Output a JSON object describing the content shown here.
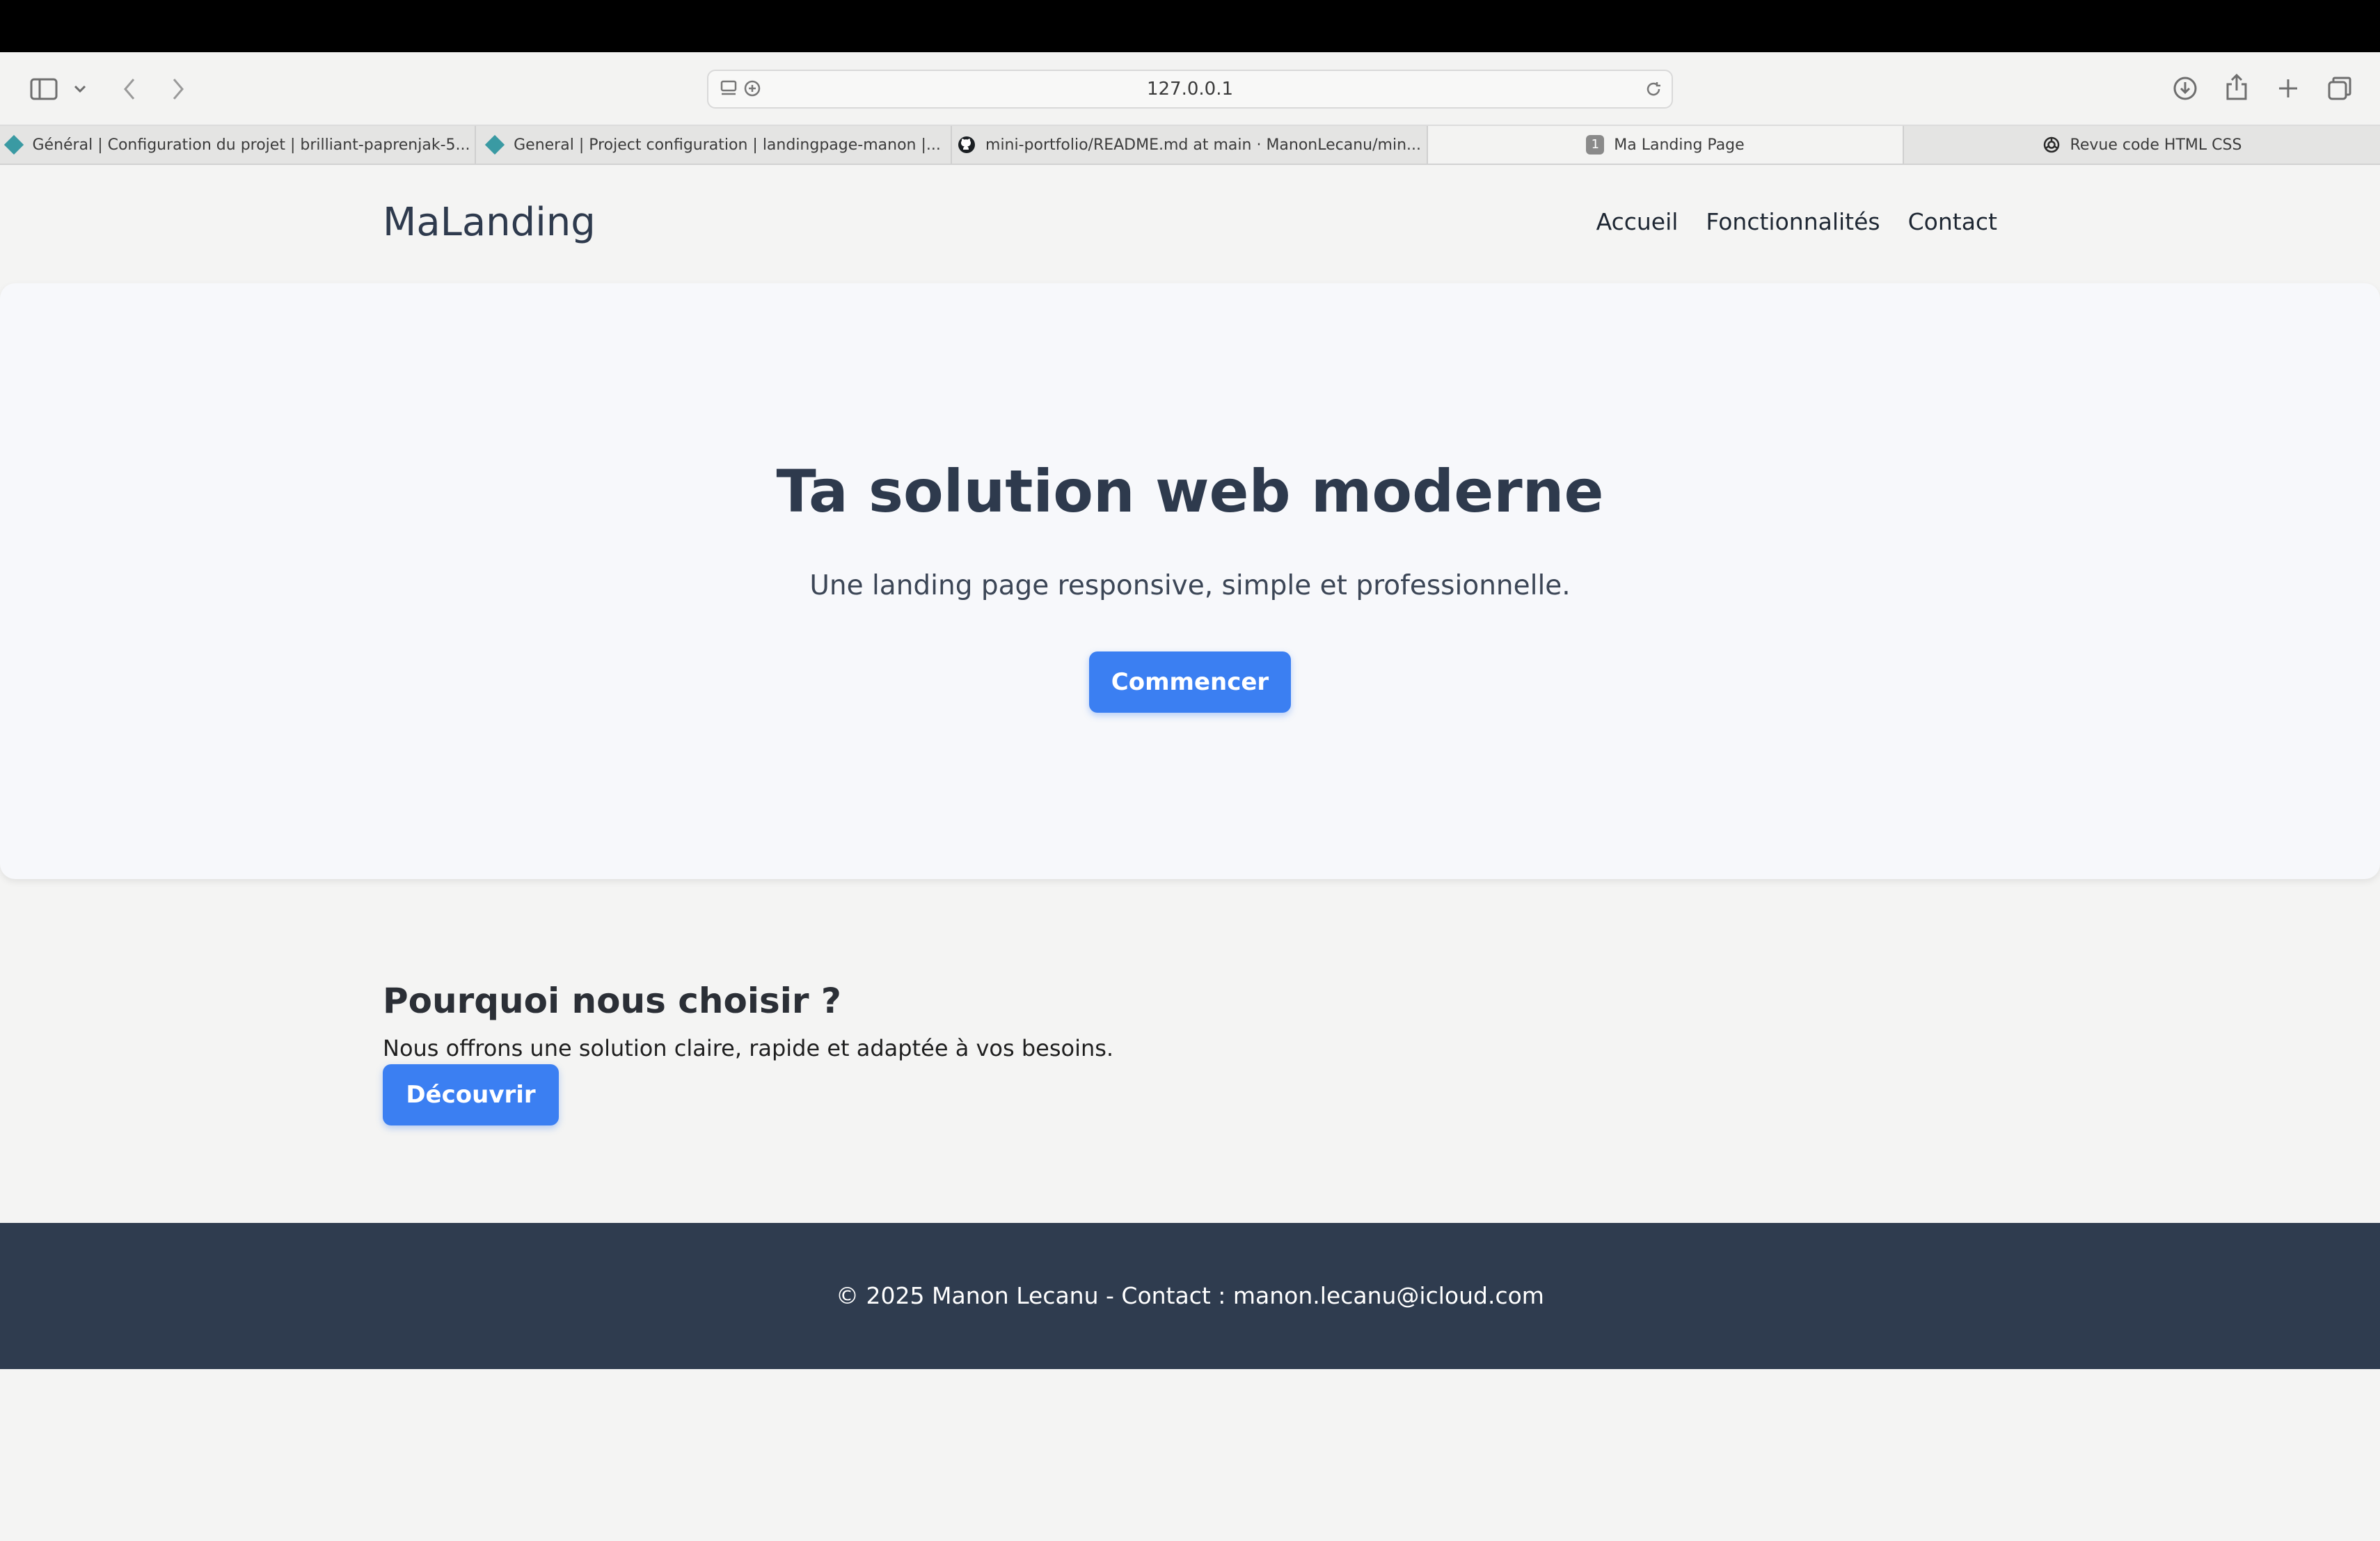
{
  "browser": {
    "address": "127.0.0.1",
    "tabs": [
      {
        "label": "Général | Configuration du projet | brilliant-paprenjak-5...",
        "icon": "netlify-diamond-icon",
        "active": false
      },
      {
        "label": "General | Project configuration | landingpage-manon |...",
        "icon": "netlify-diamond-icon",
        "active": false
      },
      {
        "label": "mini-portfolio/README.md at main · ManonLecanu/min...",
        "icon": "github-icon",
        "active": false
      },
      {
        "label": "Ma Landing Page",
        "icon": "number-badge-icon",
        "badge": "1",
        "active": true
      },
      {
        "label": "Revue code HTML CSS",
        "icon": "chatgpt-icon",
        "active": false
      }
    ]
  },
  "site": {
    "logo": "MaLanding",
    "nav": [
      "Accueil",
      "Fonctionnalités",
      "Contact"
    ],
    "hero": {
      "title": "Ta solution web moderne",
      "subtitle": "Une landing page responsive, simple et professionnelle.",
      "cta": "Commencer"
    },
    "why": {
      "title": "Pourquoi nous choisir ?",
      "text": "Nous offrons une solution claire, rapide et adaptée à vos besoins.",
      "cta": "Découvrir"
    },
    "footer": "© 2025 Manon Lecanu - Contact : manon.lecanu@icloud.com"
  },
  "colors": {
    "accent": "#3b7ff2",
    "heading": "#2e3a4d",
    "footer_bg": "#2f3c4f"
  }
}
